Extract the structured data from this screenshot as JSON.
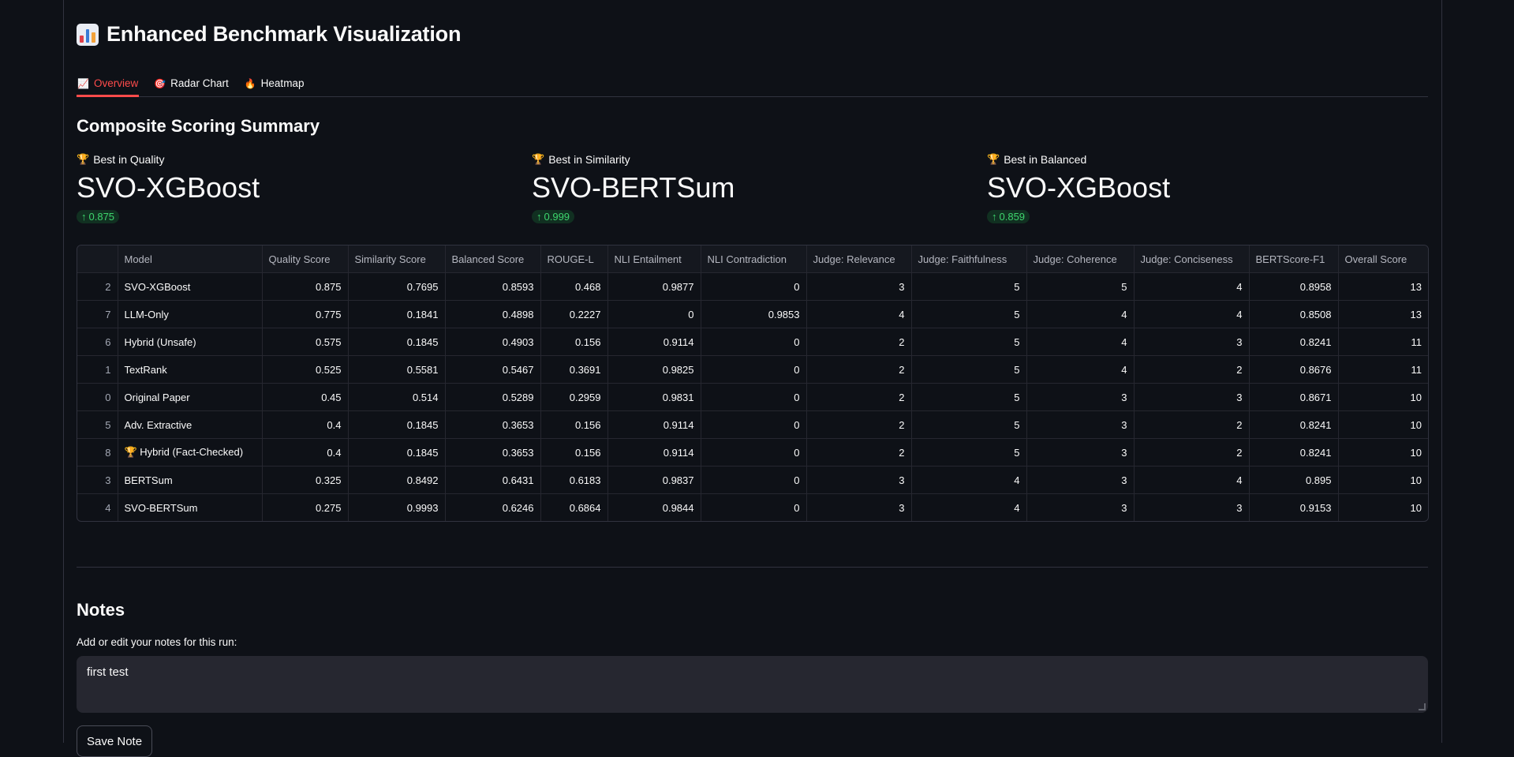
{
  "app": {
    "title": "Enhanced Benchmark Visualization",
    "icon": "bar-chart-icon"
  },
  "tabs": [
    {
      "label": "Overview",
      "icon": "chart-increasing-icon",
      "active": true
    },
    {
      "label": "Radar Chart",
      "icon": "target-icon",
      "active": false
    },
    {
      "label": "Heatmap",
      "icon": "fire-icon",
      "active": false
    }
  ],
  "summary": {
    "heading": "Composite Scoring Summary",
    "metrics": [
      {
        "label": "Best in Quality",
        "value": "SVO-XGBoost",
        "delta": "0.875"
      },
      {
        "label": "Best in Similarity",
        "value": "SVO-BERTSum",
        "delta": "0.999"
      },
      {
        "label": "Best in Balanced",
        "value": "SVO-XGBoost",
        "delta": "0.859"
      }
    ]
  },
  "table": {
    "columns": [
      "",
      "Model",
      "Quality Score",
      "Similarity Score",
      "Balanced Score",
      "ROUGE-L",
      "NLI Entailment",
      "NLI Contradiction",
      "Judge: Relevance",
      "Judge: Faithfulness",
      "Judge: Coherence",
      "Judge: Conciseness",
      "BERTScore-F1",
      "Overall Score"
    ],
    "rows": [
      [
        "2",
        "SVO-XGBoost",
        "0.875",
        "0.7695",
        "0.8593",
        "0.468",
        "0.9877",
        "0",
        "3",
        "5",
        "5",
        "4",
        "0.8958",
        "13"
      ],
      [
        "7",
        "LLM-Only",
        "0.775",
        "0.1841",
        "0.4898",
        "0.2227",
        "0",
        "0.9853",
        "4",
        "5",
        "4",
        "4",
        "0.8508",
        "13"
      ],
      [
        "6",
        "Hybrid (Unsafe)",
        "0.575",
        "0.1845",
        "0.4903",
        "0.156",
        "0.9114",
        "0",
        "2",
        "5",
        "4",
        "3",
        "0.8241",
        "11"
      ],
      [
        "1",
        "TextRank",
        "0.525",
        "0.5581",
        "0.5467",
        "0.3691",
        "0.9825",
        "0",
        "2",
        "5",
        "4",
        "2",
        "0.8676",
        "11"
      ],
      [
        "0",
        "Original Paper",
        "0.45",
        "0.514",
        "0.5289",
        "0.2959",
        "0.9831",
        "0",
        "2",
        "5",
        "3",
        "3",
        "0.8671",
        "10"
      ],
      [
        "5",
        "Adv. Extractive",
        "0.4",
        "0.1845",
        "0.3653",
        "0.156",
        "0.9114",
        "0",
        "2",
        "5",
        "3",
        "2",
        "0.8241",
        "10"
      ],
      [
        "8",
        "🏆 Hybrid (Fact-Checked)",
        "0.4",
        "0.1845",
        "0.3653",
        "0.156",
        "0.9114",
        "0",
        "2",
        "5",
        "3",
        "2",
        "0.8241",
        "10"
      ],
      [
        "3",
        "BERTSum",
        "0.325",
        "0.8492",
        "0.6431",
        "0.6183",
        "0.9837",
        "0",
        "3",
        "4",
        "3",
        "4",
        "0.895",
        "10"
      ],
      [
        "4",
        "SVO-BERTSum",
        "0.275",
        "0.9993",
        "0.6246",
        "0.6864",
        "0.9844",
        "0",
        "3",
        "4",
        "3",
        "3",
        "0.9153",
        "10"
      ]
    ]
  },
  "notes": {
    "heading": "Notes",
    "label": "Add or edit your notes for this run:",
    "value": "first test",
    "save_label": "Save Note"
  },
  "colors": {
    "background": "#0e1117",
    "accent": "#ff4b4b",
    "delta_green": "#3dd56d",
    "input_bg": "#262730"
  }
}
